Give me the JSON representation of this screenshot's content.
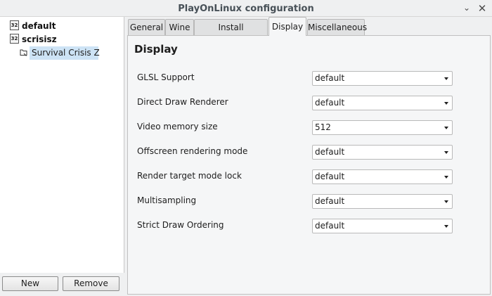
{
  "window": {
    "title": "PlayOnLinux configuration",
    "minimize_glyph": "⌄",
    "close_glyph": "✕"
  },
  "tree": {
    "prefixes": [
      {
        "arch_badge": "32",
        "name": "default"
      },
      {
        "arch_badge": "32",
        "name": "scrisisz"
      }
    ],
    "selected_game": "Survival Crisis Z"
  },
  "buttons": {
    "new": "New",
    "remove": "Remove"
  },
  "tabs": [
    "General",
    "Wine",
    "Install components",
    "Display",
    "Miscellaneous"
  ],
  "active_tab": "Display",
  "display": {
    "heading": "Display",
    "options": [
      {
        "label": "GLSL Support",
        "value": "default"
      },
      {
        "label": "Direct Draw Renderer",
        "value": "default"
      },
      {
        "label": "Video memory size",
        "value": "512"
      },
      {
        "label": "Offscreen rendering mode",
        "value": "default"
      },
      {
        "label": "Render target mode lock",
        "value": "default"
      },
      {
        "label": "Multisampling",
        "value": "default"
      },
      {
        "label": "Strict Draw Ordering",
        "value": "default"
      }
    ]
  },
  "colors": {
    "selection": "#cde3f5",
    "window_bg": "#eff0f1"
  }
}
